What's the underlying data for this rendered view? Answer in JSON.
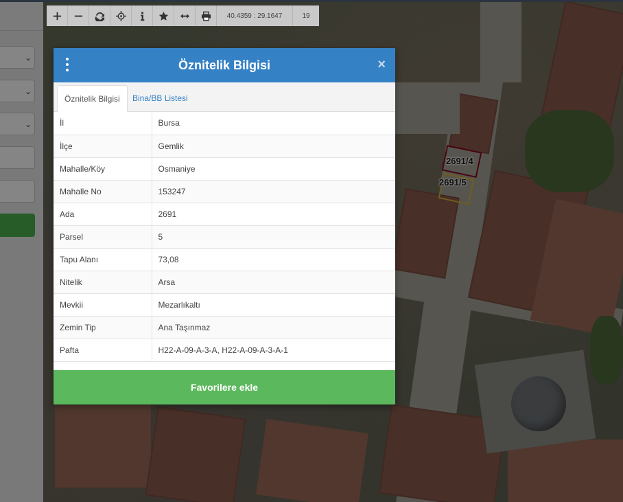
{
  "toolbar": {
    "buttons": [
      {
        "name": "zoom-in-icon"
      },
      {
        "name": "zoom-out-icon"
      },
      {
        "name": "refresh-icon"
      },
      {
        "name": "locate-icon"
      },
      {
        "name": "info-icon"
      },
      {
        "name": "star-icon"
      },
      {
        "name": "measure-icon"
      },
      {
        "name": "print-icon"
      }
    ],
    "coordinates": "40.4359 : 29.1647",
    "zoom_level": "19"
  },
  "map": {
    "parcel_labels": [
      "2691/4",
      "2691/5"
    ]
  },
  "dialog": {
    "title": "Öznitelik Bilgisi",
    "close_symbol": "×",
    "tabs": [
      {
        "label": "Öznitelik Bilgisi",
        "active": true
      },
      {
        "label": "Bina/BB Listesi",
        "active": false
      }
    ],
    "rows": [
      {
        "key": "İl",
        "value": "Bursa"
      },
      {
        "key": "İlçe",
        "value": "Gemlik"
      },
      {
        "key": "Mahalle/Köy",
        "value": "Osmaniye"
      },
      {
        "key": "Mahalle No",
        "value": "153247"
      },
      {
        "key": "Ada",
        "value": "2691"
      },
      {
        "key": "Parsel",
        "value": "5"
      },
      {
        "key": "Tapu Alanı",
        "value": "73,08"
      },
      {
        "key": "Nitelik",
        "value": "Arsa"
      },
      {
        "key": "Mevkii",
        "value": "Mezarlıkaltı"
      },
      {
        "key": "Zemin Tip",
        "value": "Ana Taşınmaz"
      },
      {
        "key": "Pafta",
        "value": "H22-A-09-A-3-A, H22-A-09-A-3-A-1"
      }
    ],
    "favorite_button": "Favorilere ekle"
  },
  "colors": {
    "header_blue": "#3581c6",
    "button_green": "#5cb85c",
    "tab_link": "#3581c6"
  }
}
